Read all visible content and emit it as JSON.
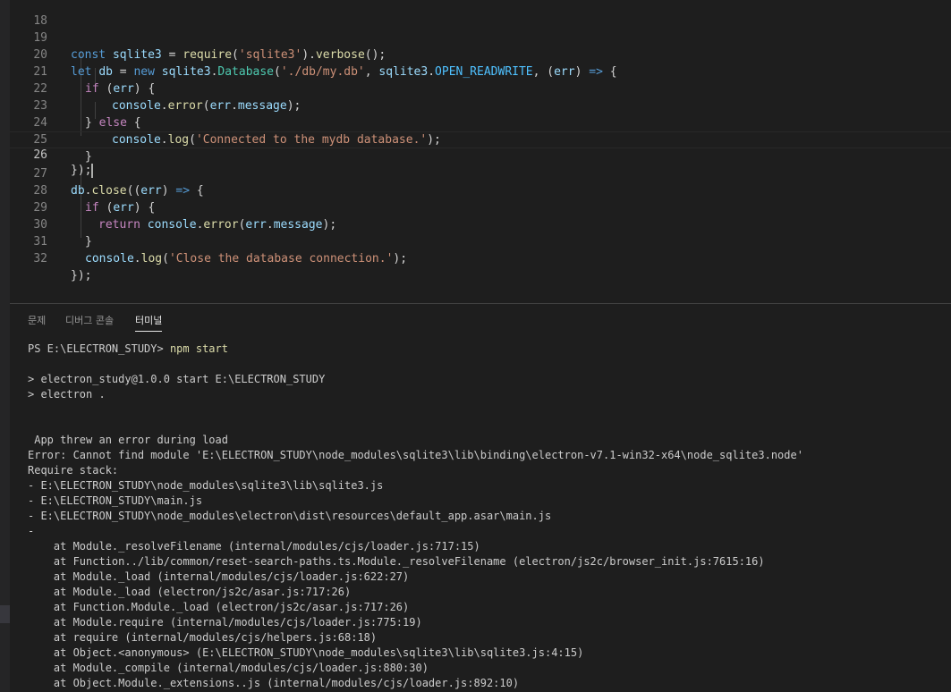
{
  "editor": {
    "lines": [
      {
        "n": "18"
      },
      {
        "n": "19"
      },
      {
        "n": "20"
      },
      {
        "n": "21"
      },
      {
        "n": "22"
      },
      {
        "n": "23"
      },
      {
        "n": "24"
      },
      {
        "n": "25"
      },
      {
        "n": "26"
      },
      {
        "n": "27"
      },
      {
        "n": "28"
      },
      {
        "n": "29"
      },
      {
        "n": "30"
      },
      {
        "n": "31"
      },
      {
        "n": "32"
      }
    ],
    "tokens": {
      "l19": [
        "const",
        " ",
        "sqlite3",
        " = ",
        "require",
        "(",
        "'sqlite3'",
        ").",
        "verbose",
        "();"
      ],
      "l20": [
        "let",
        " ",
        "db",
        " = ",
        "new",
        " ",
        "sqlite3",
        ".",
        "Database",
        "(",
        "'./db/my.db'",
        ", ",
        "sqlite3",
        ".",
        "OPEN_READWRITE",
        ", (",
        "err",
        ") ",
        "=>",
        " {"
      ],
      "l21": [
        "if",
        " (",
        "err",
        ") {"
      ],
      "l22": [
        "console",
        ".",
        "error",
        "(",
        "err",
        ".",
        "message",
        ");"
      ],
      "l23": [
        "} ",
        "else",
        " {"
      ],
      "l24": [
        "console",
        ".",
        "log",
        "(",
        "'Connected to the mydb database.'",
        ");"
      ],
      "l25": [
        "}"
      ],
      "l26": [
        "});"
      ],
      "l27": [
        "db",
        ".",
        "close",
        "((",
        "err",
        ") ",
        "=>",
        " {"
      ],
      "l28": [
        "if",
        " (",
        "err",
        ") {"
      ],
      "l29": [
        "return",
        " ",
        "console",
        ".",
        "error",
        "(",
        "err",
        ".",
        "message",
        ");"
      ],
      "l30": [
        "}"
      ],
      "l31": [
        "console",
        ".",
        "log",
        "(",
        "'Close the database connection.'",
        ");"
      ],
      "l32": [
        "});"
      ]
    }
  },
  "panel": {
    "tabs": [
      "문제",
      "디버그 콘솔",
      "터미널"
    ],
    "active_tab": "터미널",
    "terminal": {
      "prompt": "PS E:\\ELECTRON_STUDY> ",
      "command": "npm start",
      "lines": [
        "",
        "> electron_study@1.0.0 start E:\\ELECTRON_STUDY",
        "> electron .",
        "",
        "",
        " App threw an error during load",
        "Error: Cannot find module 'E:\\ELECTRON_STUDY\\node_modules\\sqlite3\\lib\\binding\\electron-v7.1-win32-x64\\node_sqlite3.node'",
        "Require stack:",
        "- E:\\ELECTRON_STUDY\\node_modules\\sqlite3\\lib\\sqlite3.js",
        "- E:\\ELECTRON_STUDY\\main.js",
        "- E:\\ELECTRON_STUDY\\node_modules\\electron\\dist\\resources\\default_app.asar\\main.js",
        "-",
        "    at Module._resolveFilename (internal/modules/cjs/loader.js:717:15)",
        "    at Function../lib/common/reset-search-paths.ts.Module._resolveFilename (electron/js2c/browser_init.js:7615:16)",
        "    at Module._load (internal/modules/cjs/loader.js:622:27)",
        "    at Module._load (electron/js2c/asar.js:717:26)",
        "    at Function.Module._load (electron/js2c/asar.js:717:26)",
        "    at Module.require (internal/modules/cjs/loader.js:775:19)",
        "    at require (internal/modules/cjs/helpers.js:68:18)",
        "    at Object.<anonymous> (E:\\ELECTRON_STUDY\\node_modules\\sqlite3\\lib\\sqlite3.js:4:15)",
        "    at Module._compile (internal/modules/cjs/loader.js:880:30)",
        "    at Object.Module._extensions..js (internal/modules/cjs/loader.js:892:10)"
      ]
    }
  },
  "colors": {
    "background": "#1e1e1e",
    "keyword": "#569cd6",
    "control": "#c586c0",
    "variable": "#9cdcfe",
    "function": "#dcdcaa",
    "string": "#ce9178",
    "class": "#4ec9b0",
    "constant": "#4fc1ff"
  }
}
